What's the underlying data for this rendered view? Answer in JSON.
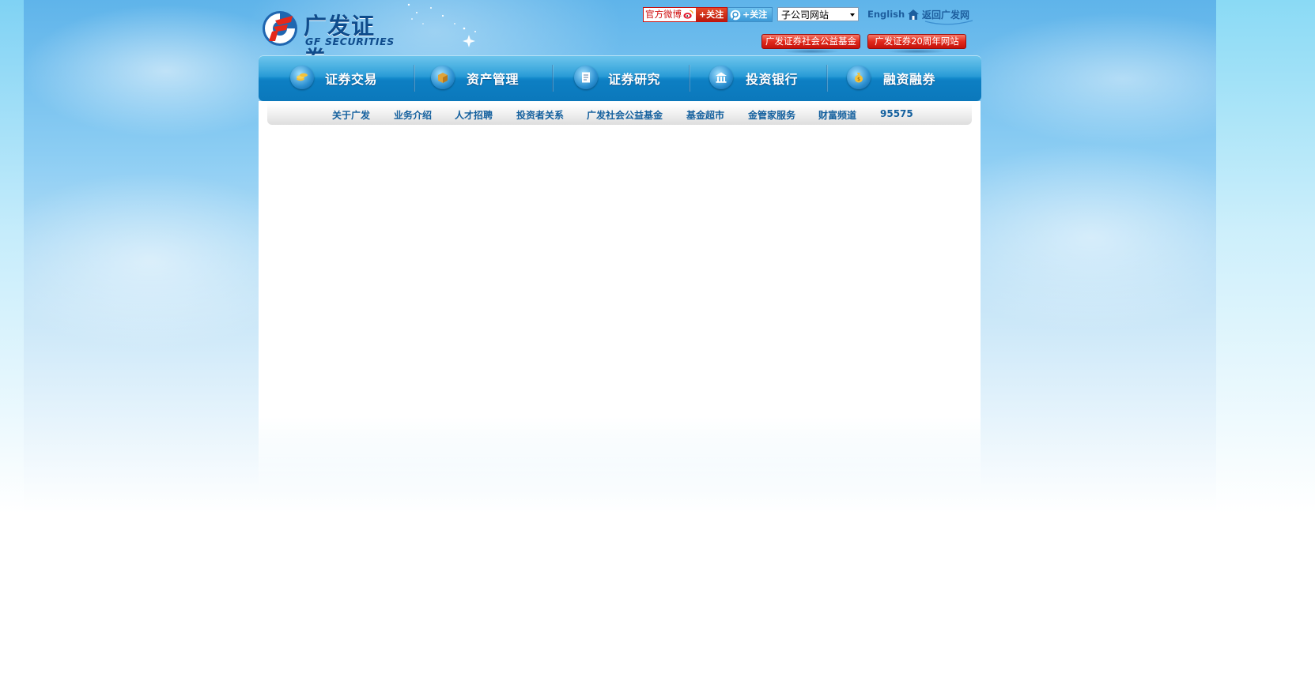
{
  "colors": {
    "nav_blue": "#1b95d4",
    "link_blue": "#14609e",
    "red_button": "#e22a1c",
    "logo_red": "#e4281a",
    "logo_blue": "#0f4c8c"
  },
  "header": {
    "logo": {
      "cn": "广发证券",
      "en": "GF SECURITIES"
    },
    "weibo": {
      "label": "官方微博",
      "follow": "+关注",
      "icon": "sina-weibo-icon"
    },
    "tencent_weibo": {
      "follow": "+关注",
      "icon": "tencent-weibo-icon"
    },
    "subsite_select": {
      "value": "子公司网站"
    },
    "english": "English",
    "home": {
      "label": "返回广发网",
      "icon": "home-icon"
    },
    "charity_button": "广发证券社会公益基金",
    "anniversary_button": "广发证券20周年网站"
  },
  "main_nav": [
    {
      "label": "证券交易",
      "icon": "coins-icon"
    },
    {
      "label": "资产管理",
      "icon": "box-icon"
    },
    {
      "label": "证券研究",
      "icon": "document-icon"
    },
    {
      "label": "投资银行",
      "icon": "bank-icon"
    },
    {
      "label": "融资融券",
      "icon": "money-bag-icon"
    }
  ],
  "sub_nav": [
    "关于广发",
    "业务介绍",
    "人才招聘",
    "投资者关系",
    "广发社会公益基金",
    "基金超市",
    "金管家服务",
    "财富频道",
    "95575"
  ]
}
